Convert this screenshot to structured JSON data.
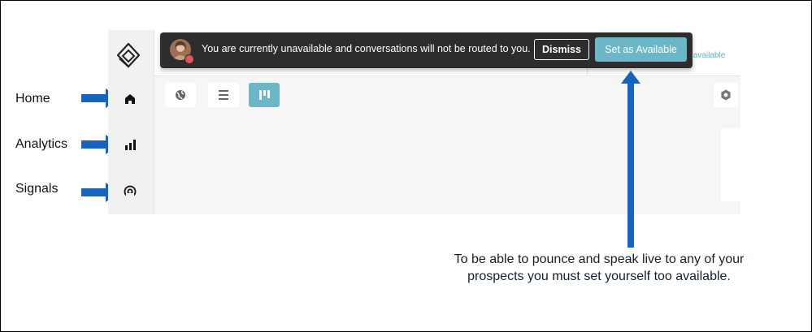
{
  "nav_labels": {
    "home": "Home",
    "analytics": "Analytics",
    "signals": "Signals"
  },
  "banner": {
    "message": "You are currently unavailable and conversations will not be routed to you.",
    "dismiss_label": "Dismiss",
    "set_available_label": "Set as Available"
  },
  "topbar": {
    "status_partial": "s available"
  },
  "caption": "To be able to pounce and speak live to any of your prospects you must set yourself too available.",
  "colors": {
    "accent": "#6bb7c8",
    "arrow": "#1565c0",
    "banner_bg": "#2d2d2d",
    "status_dot": "#e2555a"
  },
  "icons": [
    "app-logo-icon",
    "home-icon",
    "analytics-icon",
    "signals-icon",
    "globe-view-icon",
    "list-view-icon",
    "board-view-icon",
    "settings-gear-icon"
  ]
}
